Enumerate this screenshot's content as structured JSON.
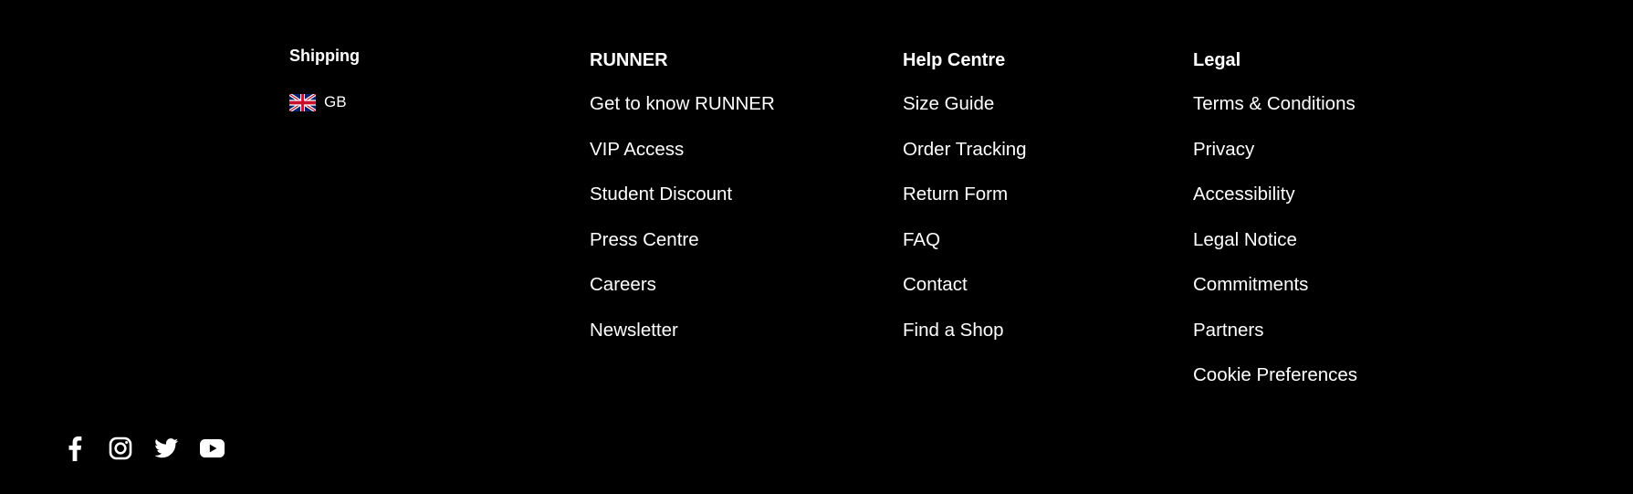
{
  "shipping": {
    "title": "Shipping",
    "country_code": "GB",
    "flag_icon": "uk-flag-icon"
  },
  "columns": [
    {
      "title": "RUNNER",
      "links": [
        "Get to know RUNNER",
        "VIP Access",
        "Student Discount",
        "Press Centre",
        "Careers",
        "Newsletter"
      ]
    },
    {
      "title": "Help Centre",
      "links": [
        "Size Guide",
        "Order Tracking",
        "Return Form",
        "FAQ",
        "Contact",
        "Find a Shop"
      ]
    },
    {
      "title": "Legal",
      "links": [
        "Terms & Conditions",
        "Privacy",
        "Accessibility",
        "Legal Notice",
        "Commitments",
        "Partners",
        "Cookie Preferences"
      ]
    }
  ],
  "social": [
    "facebook-icon",
    "instagram-icon",
    "twitter-icon",
    "youtube-icon"
  ],
  "colors": {
    "background": "#000000",
    "text": "#ffffff"
  }
}
